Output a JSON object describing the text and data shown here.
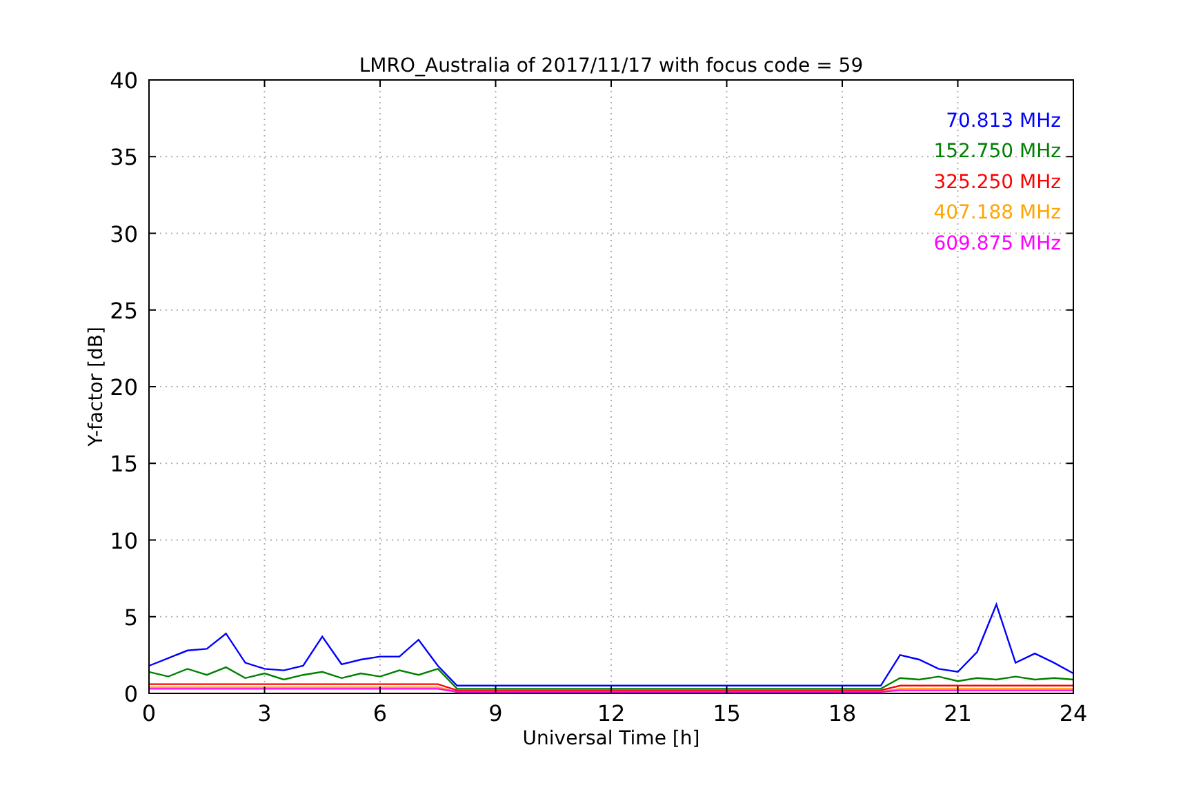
{
  "figure": {
    "chart_data": {
      "type": "line",
      "grid": true,
      "title": "LMRO_Australia of 2017/11/17 with focus code = 59",
      "xlabel": "Universal Time [h]",
      "ylabel": "Y-factor [dB]",
      "xlim": [
        0,
        24
      ],
      "ylim": [
        0,
        40
      ],
      "xticks": [
        0,
        3,
        6,
        9,
        12,
        15,
        18,
        21,
        24
      ],
      "yticks": [
        0,
        5,
        10,
        15,
        20,
        25,
        30,
        35,
        40
      ],
      "x": [
        0,
        0.5,
        1,
        1.5,
        2,
        2.5,
        3,
        3.5,
        4,
        4.5,
        5,
        5.5,
        6,
        6.5,
        7,
        7.5,
        8,
        8.5,
        9,
        9.5,
        10,
        10.5,
        11,
        11.5,
        12,
        12.5,
        13,
        13.5,
        14,
        14.5,
        15,
        15.5,
        16,
        16.5,
        17,
        17.5,
        18,
        18.5,
        19,
        19.5,
        20,
        20.5,
        21,
        21.5,
        22,
        22.5,
        23,
        23.5,
        24
      ],
      "series": [
        {
          "name": "70.813 MHz",
          "color": "#0000ff",
          "values": [
            1.8,
            2.3,
            2.8,
            2.9,
            3.9,
            2.0,
            1.6,
            1.5,
            1.8,
            3.7,
            1.9,
            2.2,
            2.4,
            2.4,
            3.5,
            1.8,
            0.5,
            0.5,
            0.5,
            0.5,
            0.5,
            0.5,
            0.5,
            0.5,
            0.5,
            0.5,
            0.5,
            0.5,
            0.5,
            0.5,
            0.5,
            0.5,
            0.5,
            0.5,
            0.5,
            0.5,
            0.5,
            0.5,
            0.5,
            2.5,
            2.2,
            1.6,
            1.4,
            2.7,
            5.8,
            2.0,
            2.6,
            2.0,
            1.3
          ]
        },
        {
          "name": "152.750 MHz",
          "color": "#008000",
          "values": [
            1.4,
            1.1,
            1.6,
            1.2,
            1.7,
            1.0,
            1.3,
            0.9,
            1.2,
            1.4,
            1.0,
            1.3,
            1.1,
            1.5,
            1.2,
            1.6,
            0.3,
            0.3,
            0.3,
            0.3,
            0.3,
            0.3,
            0.3,
            0.3,
            0.3,
            0.3,
            0.3,
            0.3,
            0.3,
            0.3,
            0.3,
            0.3,
            0.3,
            0.3,
            0.3,
            0.3,
            0.3,
            0.3,
            0.3,
            1.0,
            0.9,
            1.1,
            0.8,
            1.0,
            0.9,
            1.1,
            0.9,
            1.0,
            0.9
          ]
        },
        {
          "name": "325.250 MHz",
          "color": "#ff0000",
          "values": [
            0.6,
            0.6,
            0.6,
            0.6,
            0.6,
            0.6,
            0.6,
            0.6,
            0.6,
            0.6,
            0.6,
            0.6,
            0.6,
            0.6,
            0.6,
            0.6,
            0.2,
            0.2,
            0.2,
            0.2,
            0.2,
            0.2,
            0.2,
            0.2,
            0.2,
            0.2,
            0.2,
            0.2,
            0.2,
            0.2,
            0.2,
            0.2,
            0.2,
            0.2,
            0.2,
            0.2,
            0.2,
            0.2,
            0.2,
            0.5,
            0.5,
            0.5,
            0.5,
            0.5,
            0.5,
            0.5,
            0.5,
            0.5,
            0.5
          ]
        },
        {
          "name": "407.188 MHz",
          "color": "#ffa500",
          "values": [
            0.4,
            0.4,
            0.4,
            0.4,
            0.4,
            0.4,
            0.4,
            0.4,
            0.4,
            0.4,
            0.4,
            0.4,
            0.4,
            0.4,
            0.4,
            0.4,
            0.1,
            0.1,
            0.1,
            0.1,
            0.1,
            0.1,
            0.1,
            0.1,
            0.1,
            0.1,
            0.1,
            0.1,
            0.1,
            0.1,
            0.1,
            0.1,
            0.1,
            0.1,
            0.1,
            0.1,
            0.1,
            0.1,
            0.1,
            0.3,
            0.3,
            0.3,
            0.3,
            0.3,
            0.3,
            0.3,
            0.3,
            0.3,
            0.3
          ]
        },
        {
          "name": "609.875 MHz",
          "color": "#ff00ff",
          "values": [
            0.3,
            0.3,
            0.3,
            0.3,
            0.3,
            0.3,
            0.3,
            0.3,
            0.3,
            0.3,
            0.3,
            0.3,
            0.3,
            0.3,
            0.3,
            0.3,
            0.1,
            0.1,
            0.1,
            0.1,
            0.1,
            0.1,
            0.1,
            0.1,
            0.1,
            0.1,
            0.1,
            0.1,
            0.1,
            0.1,
            0.1,
            0.1,
            0.1,
            0.1,
            0.1,
            0.1,
            0.1,
            0.1,
            0.1,
            0.2,
            0.2,
            0.2,
            0.2,
            0.2,
            0.2,
            0.2,
            0.2,
            0.2,
            0.2
          ]
        }
      ]
    }
  }
}
